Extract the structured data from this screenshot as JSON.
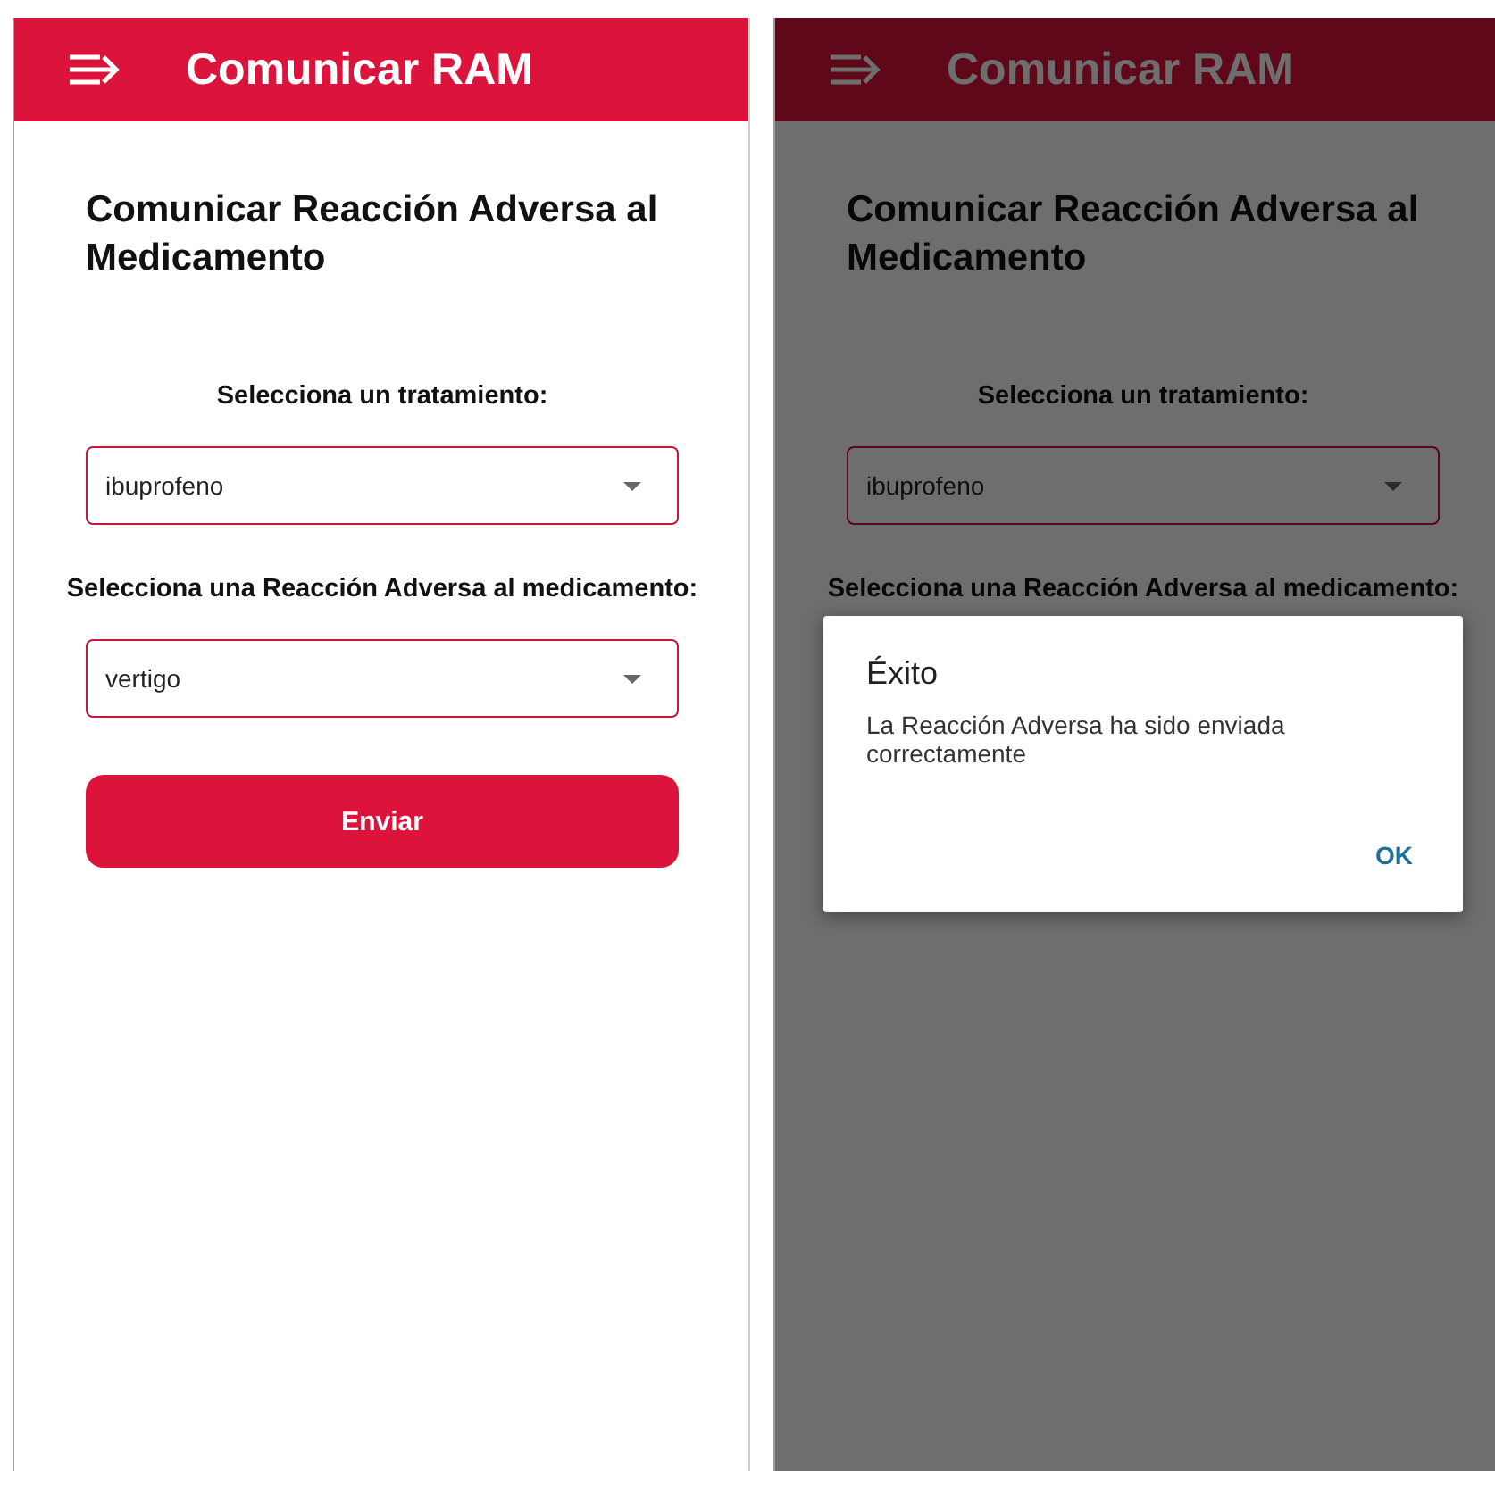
{
  "screens": [
    {
      "dimmed": false,
      "app_bar": {
        "title": "Comunicar RAM"
      },
      "heading": "Comunicar Reacción Adversa al Medicamento",
      "fields": [
        {
          "label": "Selecciona un tratamiento:",
          "value": "ibuprofeno"
        },
        {
          "label": "Selecciona una Reacción Adversa al medicamento:",
          "value": "vertigo"
        }
      ],
      "button": "Enviar"
    },
    {
      "dimmed": true,
      "app_bar": {
        "title": "Comunicar RAM"
      },
      "heading": "Comunicar Reacción Adversa al Medicamento",
      "fields": [
        {
          "label": "Selecciona un tratamiento:",
          "value": "ibuprofeno"
        },
        {
          "label": "Selecciona una Reacción Adversa al medicamento:"
        }
      ],
      "dialog": {
        "title": "Éxito",
        "message": "La Reacción Adversa ha sido enviada correctamente",
        "action": "OK"
      }
    }
  ]
}
